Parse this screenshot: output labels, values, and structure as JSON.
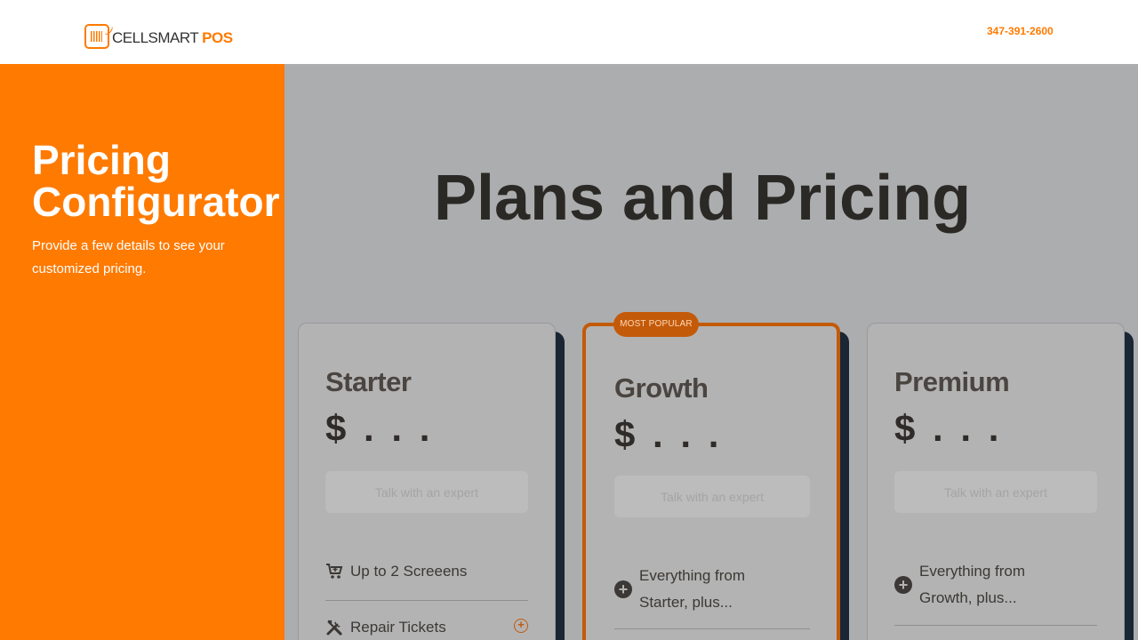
{
  "header": {
    "logo_text_main": "CELLSMART",
    "logo_text_accent": "POS",
    "phone": "347-391-2600"
  },
  "sidebar": {
    "title_line1": "Pricing",
    "title_line2": "Configurator",
    "subtitle": "Provide a few details to see your customized pricing."
  },
  "main": {
    "title": "Plans and Pricing"
  },
  "plans": [
    {
      "name": "Starter",
      "price": "$ . . .",
      "cta": "Talk with an expert",
      "features": [
        {
          "icon": "cart-icon",
          "label": "Up to 2 Screeens"
        },
        {
          "icon": "tools-icon",
          "label": "Repair Tickets"
        }
      ]
    },
    {
      "name": "Growth",
      "badge": "MOST POPULAR",
      "price": "$ . . .",
      "cta": "Talk with an expert",
      "features": [
        {
          "icon": "plus-circle-icon",
          "label": "Everything from Starter, plus..."
        }
      ]
    },
    {
      "name": "Premium",
      "price": "$ . . .",
      "cta": "Talk with an expert",
      "features": [
        {
          "icon": "plus-circle-icon",
          "label": "Everything from Growth, plus..."
        }
      ]
    }
  ],
  "colors": {
    "accent": "#ff7a00",
    "featured_border": "#c35a0a",
    "overlay": "#acadaf",
    "card_shadow": "#1b2634"
  }
}
